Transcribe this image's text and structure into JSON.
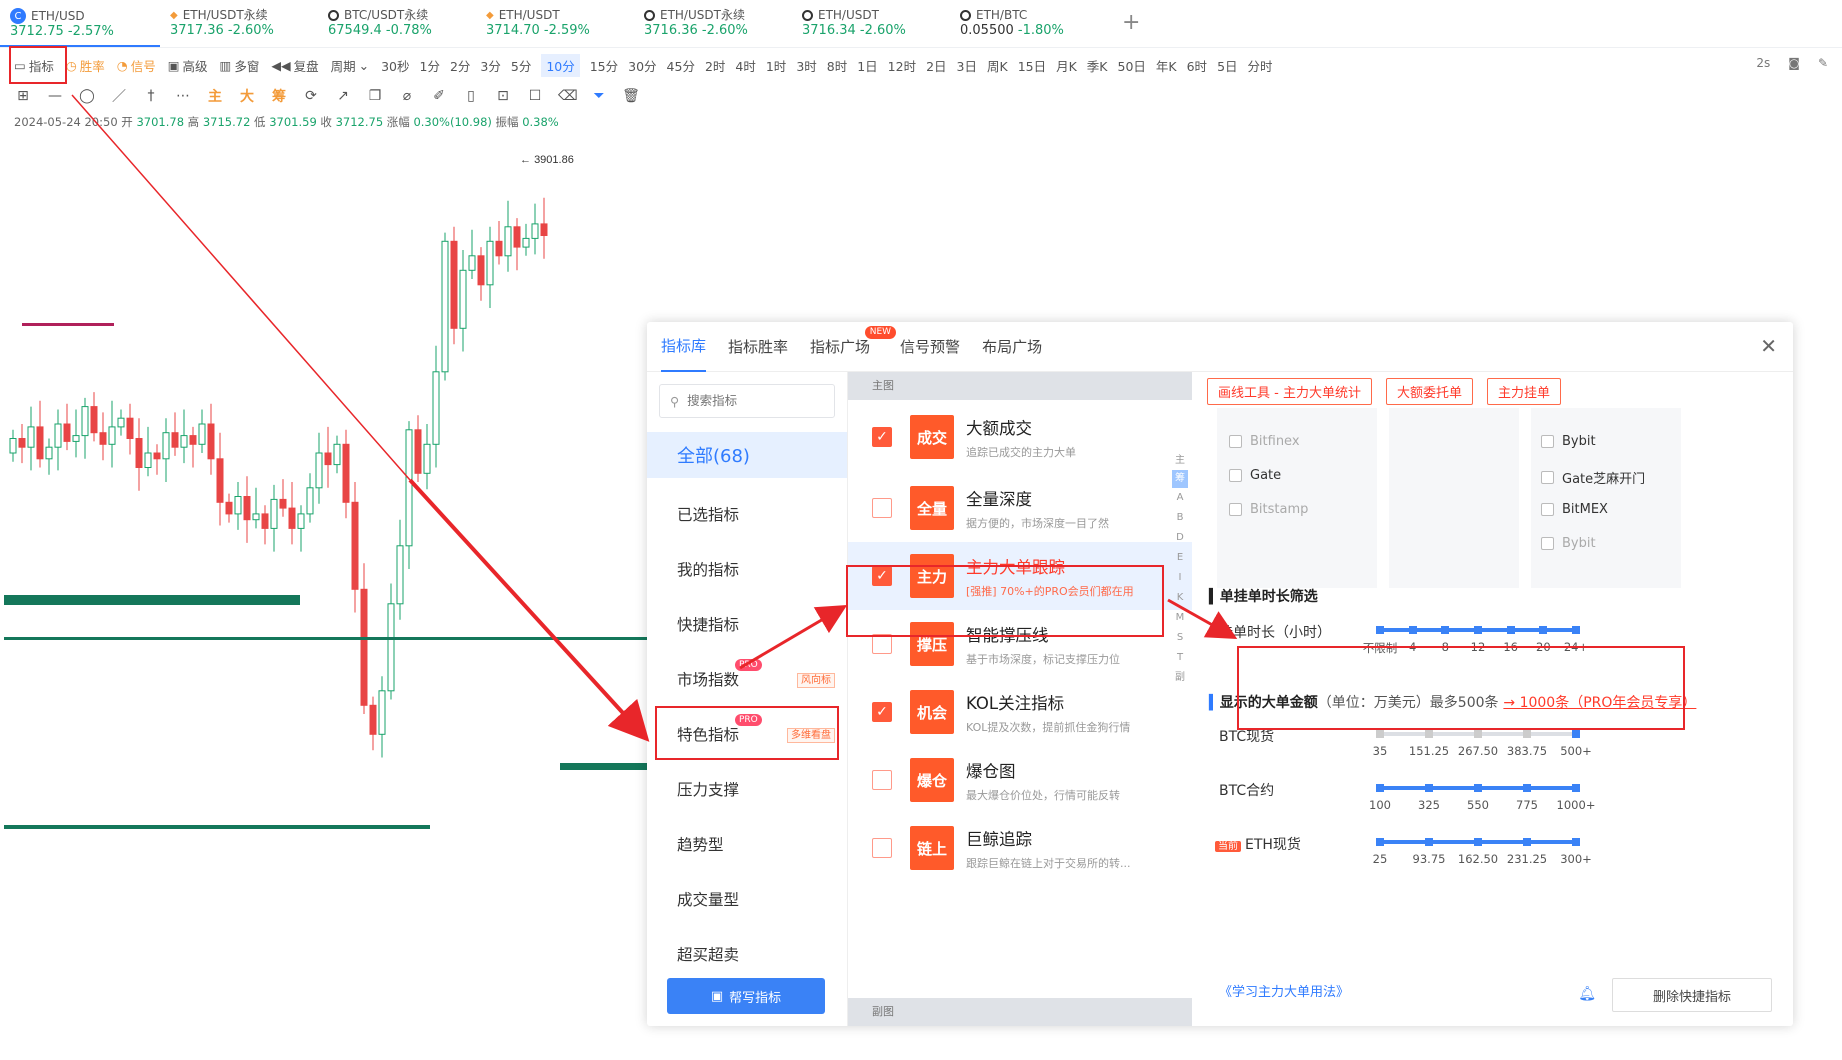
{
  "tickers": [
    {
      "symbol": "ETH/USD",
      "price": "3712.75",
      "change": "-2.57%",
      "icon": "coinbase-icon"
    },
    {
      "symbol": "ETH/USDT永续",
      "price": "3717.36",
      "change": "-2.60%",
      "icon": "binance-icon"
    },
    {
      "symbol": "BTC/USDT永续",
      "price": "67549.4",
      "change": "-0.78%",
      "icon": "okx-icon"
    },
    {
      "symbol": "ETH/USDT",
      "price": "3714.70",
      "change": "-2.59%",
      "icon": "binance-icon"
    },
    {
      "symbol": "ETH/USDT永续",
      "price": "3716.36",
      "change": "-2.60%",
      "icon": "okx-icon"
    },
    {
      "symbol": "ETH/USDT",
      "price": "3716.34",
      "change": "-2.60%",
      "icon": "okx-icon"
    },
    {
      "symbol": "ETH/BTC",
      "price": "0.05500",
      "change": "-1.80%",
      "icon": "okx-icon"
    }
  ],
  "toolbar": {
    "left": [
      "指标",
      "胜率",
      "信号",
      "高级",
      "多窗",
      "复盘",
      "周期"
    ],
    "periods": [
      "30秒",
      "1分",
      "2分",
      "3分",
      "5分",
      "10分",
      "15分",
      "30分",
      "45分",
      "2时",
      "4时",
      "1时",
      "3时",
      "8时",
      "1日",
      "12时",
      "2日",
      "3日",
      "周K",
      "15日",
      "月K",
      "季K",
      "50日",
      "年K",
      "6时",
      "5日",
      "分时"
    ],
    "selected_period": "10分",
    "right": [
      "2s"
    ]
  },
  "tools_text": [
    "主",
    "大",
    "筹"
  ],
  "ohlc": {
    "datetime": "2024-05-24 20:50",
    "open_label": "开",
    "open": "3701.78",
    "high_label": "高",
    "high": "3715.72",
    "low_label": "低",
    "low": "3701.59",
    "close_label": "收",
    "close": "3712.75",
    "change_label": "涨幅",
    "change": "0.30%(10.98)",
    "amp_label": "振幅",
    "amp": "0.38%"
  },
  "chart": {
    "high_label": "3901.86",
    "colors": {
      "up": "#1aa36b",
      "down": "#e84545",
      "level": "#14775a",
      "maroon": "#b0205a"
    }
  },
  "panel": {
    "tabs": [
      "指标库",
      "指标胜率",
      "指标广场",
      "信号预警",
      "布局广场"
    ],
    "active_tab": "指标库",
    "new_badge": "NEW",
    "search_placeholder": "搜索指标",
    "categories": [
      {
        "label": "全部(68)",
        "active": true
      },
      {
        "label": "已选指标"
      },
      {
        "label": "我的指标"
      },
      {
        "label": "快捷指标"
      },
      {
        "label": "市场指数",
        "pro": "PRO",
        "tag": "风向标"
      },
      {
        "label": "特色指标",
        "pro": "PRO",
        "tag": "多维看盘"
      },
      {
        "label": "压力支撑"
      },
      {
        "label": "趋势型"
      },
      {
        "label": "成交量型"
      },
      {
        "label": "超买超卖"
      }
    ],
    "help_button": "帮写指标",
    "main_section": "主图",
    "sub_section": "副图",
    "alpha_index": [
      "主",
      "筹",
      "A",
      "B",
      "D",
      "E",
      "I",
      "K",
      "M",
      "S",
      "T",
      "副"
    ],
    "indicators": [
      {
        "badge": "成交",
        "name": "大额成交",
        "desc": "追踪已成交的主力大单",
        "checked": true
      },
      {
        "badge": "全量",
        "name": "全量深度",
        "desc": "据方便的，市场深度一目了然",
        "checked": false
      },
      {
        "badge": "主力",
        "name": "主力大单跟踪",
        "desc": "[强推] 70%+的PRO会员们都在用",
        "checked": true,
        "highlight": true
      },
      {
        "badge": "撑压",
        "name": "智能撑压线",
        "desc": "基于市场深度，标记支撑压力位",
        "checked": false
      },
      {
        "badge": "机会",
        "name": "KOL关注指标",
        "desc": "KOL提及次数，提前抓住金狗行情",
        "checked": true
      },
      {
        "badge": "爆仓",
        "name": "爆仓图",
        "desc": "最大爆仓价位处，行情可能反转",
        "checked": false
      },
      {
        "badge": "链上",
        "name": "巨鲸追踪",
        "desc": "跟踪巨鲸在链上对于交易所的转...",
        "checked": false
      }
    ],
    "chips": [
      "画线工具 - 主力大单统计",
      "大额委托单",
      "主力挂单"
    ],
    "exchanges_left": [
      {
        "name": "Bitfinex",
        "dim": true
      },
      {
        "name": "Gate",
        "dim": false
      },
      {
        "name": "Bitstamp",
        "dim": true
      }
    ],
    "exchanges_right": [
      {
        "name": "Bybit",
        "dim": false
      },
      {
        "name": "Gate芝麻开门",
        "dim": false
      },
      {
        "name": "BitMEX",
        "dim": false
      },
      {
        "name": "Bybit",
        "dim": true
      }
    ],
    "order_filter_title": "单挂单时长筛选",
    "duration_label": "挂单时长（小时）",
    "duration_ticks": [
      "不限制",
      "4",
      "8",
      "12",
      "16",
      "20",
      "24+"
    ],
    "amount_title": "显示的大单金额",
    "amount_unit": "（单位：万美元）最多500条",
    "amount_link": "→ 1000条（PRO年会员专享）",
    "amount_rows": [
      {
        "label": "BTC现货",
        "ticks": [
          "35",
          "151.25",
          "267.50",
          "383.75",
          "500+"
        ],
        "current": false,
        "grey": true
      },
      {
        "label": "BTC合约",
        "ticks": [
          "100",
          "325",
          "550",
          "775",
          "1000+"
        ],
        "current": false,
        "grey": false
      },
      {
        "label": "ETH现货",
        "ticks": [
          "25",
          "93.75",
          "162.50",
          "231.25",
          "300+"
        ],
        "current": true,
        "current_tag": "当前",
        "grey": false
      }
    ],
    "learn_link": "《学习主力大单用法》",
    "delete_button": "删除快捷指标"
  }
}
